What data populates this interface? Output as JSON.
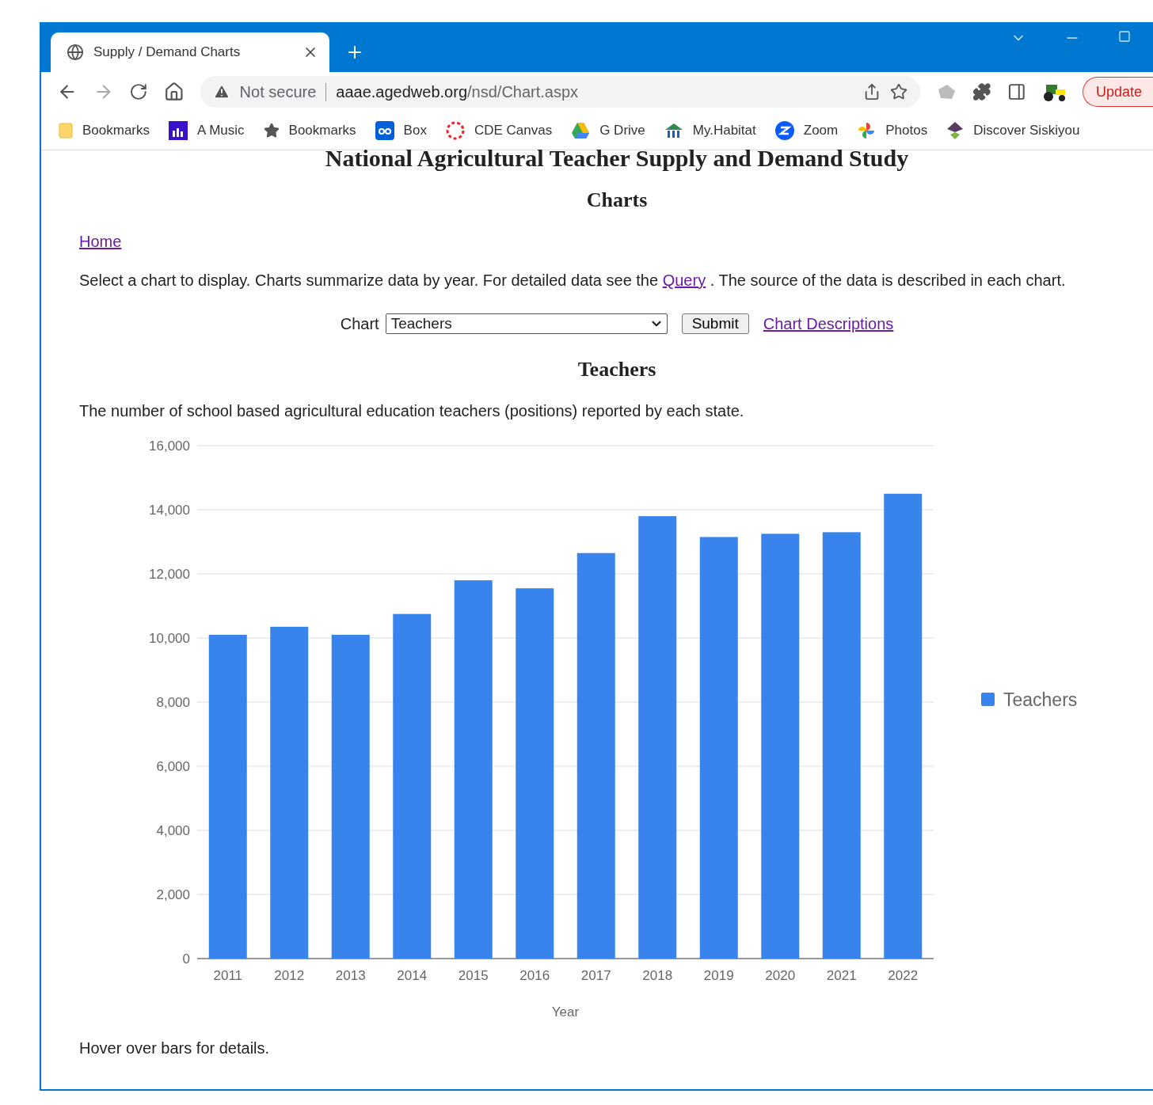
{
  "browser": {
    "tab": {
      "title": "Supply / Demand Charts",
      "selected": true
    },
    "address": {
      "security": "Not secure",
      "host": "aaae.agedweb.org",
      "path": "/nsd/Chart.aspx"
    },
    "update_button": "Update",
    "bookmarks": [
      {
        "label": "Bookmarks",
        "kind": "folder"
      },
      {
        "label": "A Music",
        "kind": "music"
      },
      {
        "label": "Bookmarks",
        "kind": "star"
      },
      {
        "label": "Box",
        "kind": "box"
      },
      {
        "label": "CDE Canvas",
        "kind": "canvas"
      },
      {
        "label": "G Drive",
        "kind": "drive"
      },
      {
        "label": "My.Habitat",
        "kind": "habitat"
      },
      {
        "label": "Zoom",
        "kind": "zoom"
      },
      {
        "label": "Photos",
        "kind": "photos"
      },
      {
        "label": "Discover Siskiyou",
        "kind": "siskiyou"
      }
    ]
  },
  "page": {
    "title": "National Agricultural Teacher Supply and Demand Study",
    "subtitle": "Charts",
    "home_link": "Home",
    "intro_before": "Select a chart to display.  Charts summarize data by year.  For detailed data see the",
    "intro_link": "Query",
    "intro_after": ".  The source of the data is described in each chart.",
    "form": {
      "label": "Chart",
      "select_value": "Teachers",
      "submit": "Submit",
      "descriptions_link": "Chart Descriptions"
    },
    "chart_title": "Teachers",
    "description": "The number of school based agricultural education teachers (positions) reported by each state.",
    "chart_data": {
      "type": "bar",
      "xlabel": "Year",
      "categories": [
        "2011",
        "2012",
        "2013",
        "2014",
        "2015",
        "2016",
        "2017",
        "2018",
        "2019",
        "2020",
        "2021",
        "2022"
      ],
      "series": [
        {
          "name": "Teachers",
          "color": "#3884ec",
          "values": [
            10100,
            10350,
            10100,
            10750,
            11800,
            11550,
            12650,
            13800,
            13150,
            13250,
            13300,
            14500
          ]
        }
      ],
      "grid": true,
      "ylim": [
        0,
        16000
      ],
      "yticks": [
        {
          "value": 0,
          "label": "0"
        },
        {
          "value": 2000,
          "label": "2,000"
        },
        {
          "value": 4000,
          "label": "4,000"
        },
        {
          "value": 6000,
          "label": "6,000"
        },
        {
          "value": 8000,
          "label": "8,000"
        },
        {
          "value": 10000,
          "label": "10,000"
        },
        {
          "value": 12000,
          "label": "12,000"
        },
        {
          "value": 14000,
          "label": "14,000"
        },
        {
          "value": 16000,
          "label": "16,000"
        }
      ]
    },
    "footer": "Hover over bars for details."
  }
}
